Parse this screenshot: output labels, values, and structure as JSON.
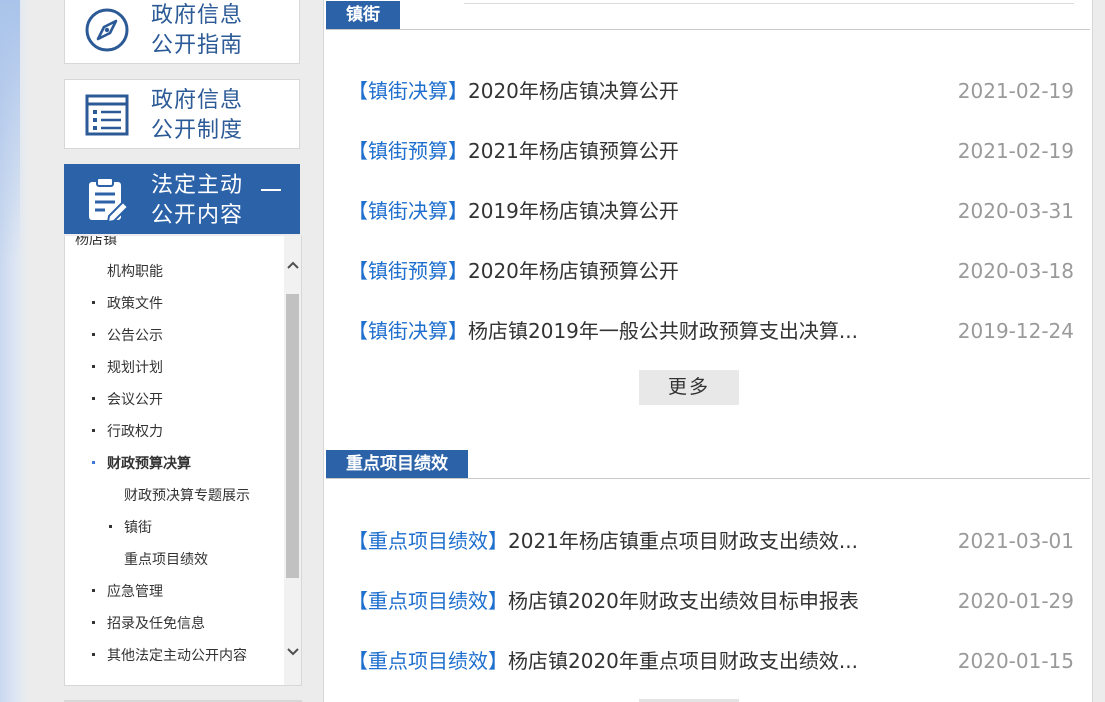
{
  "sidebar": {
    "nav": [
      {
        "label_line1": "政府信息",
        "label_line2": "公开指南",
        "icon": "compass-icon"
      },
      {
        "label_line1": "政府信息",
        "label_line2": "公开制度",
        "icon": "list-document-icon"
      },
      {
        "label_line1": "法定主动",
        "label_line2": "公开内容",
        "icon": "clipboard-edit-icon",
        "toggle": "collapse"
      }
    ],
    "sub_items": [
      {
        "label": "杨店镇",
        "bullet": false,
        "indent": 0
      },
      {
        "label": "机构职能",
        "bullet": false,
        "indent": 1
      },
      {
        "label": "政策文件",
        "bullet": true,
        "indent": 1
      },
      {
        "label": "公告公示",
        "bullet": true,
        "indent": 1
      },
      {
        "label": "规划计划",
        "bullet": true,
        "indent": 1
      },
      {
        "label": "会议公开",
        "bullet": true,
        "indent": 1
      },
      {
        "label": "行政权力",
        "bullet": true,
        "indent": 1
      },
      {
        "label": "财政预算决算",
        "bullet": true,
        "indent": 1,
        "current": true
      },
      {
        "label": "财政预决算专题展示",
        "bullet": false,
        "indent": 2
      },
      {
        "label": "镇街",
        "bullet": true,
        "indent": 2
      },
      {
        "label": "重点项目绩效",
        "bullet": false,
        "indent": 2
      },
      {
        "label": "应急管理",
        "bullet": true,
        "indent": 1
      },
      {
        "label": "招录及任免信息",
        "bullet": true,
        "indent": 1
      },
      {
        "label": "其他法定主动公开内容",
        "bullet": true,
        "indent": 1
      }
    ],
    "scroll_up": "^",
    "scroll_down": "v"
  },
  "sections": [
    {
      "tab": "镇街",
      "items": [
        {
          "category": "【镇街决算】",
          "title": "2020年杨店镇决算公开",
          "date": "2021-02-19"
        },
        {
          "category": "【镇街预算】",
          "title": "2021年杨店镇预算公开",
          "date": "2021-02-19"
        },
        {
          "category": "【镇街决算】",
          "title": "2019年杨店镇决算公开",
          "date": "2020-03-31"
        },
        {
          "category": "【镇街预算】",
          "title": "2020年杨店镇预算公开",
          "date": "2020-03-18"
        },
        {
          "category": "【镇街决算】",
          "title": "杨店镇2019年一般公共财政预算支出决算...",
          "date": "2019-12-24"
        }
      ],
      "more": "更多"
    },
    {
      "tab": "重点项目绩效",
      "items": [
        {
          "category": "【重点项目绩效】",
          "title": "2021年杨店镇重点项目财政支出绩效...",
          "date": "2021-03-01"
        },
        {
          "category": "【重点项目绩效】",
          "title": "杨店镇2020年财政支出绩效目标申报表",
          "date": "2020-01-29"
        },
        {
          "category": "【重点项目绩效】",
          "title": "杨店镇2020年重点项目财政支出绩效...",
          "date": "2020-01-15"
        }
      ]
    }
  ],
  "colors": {
    "accent": "#2b62a8",
    "link": "#1e6fce",
    "date": "#9a9a9a"
  }
}
